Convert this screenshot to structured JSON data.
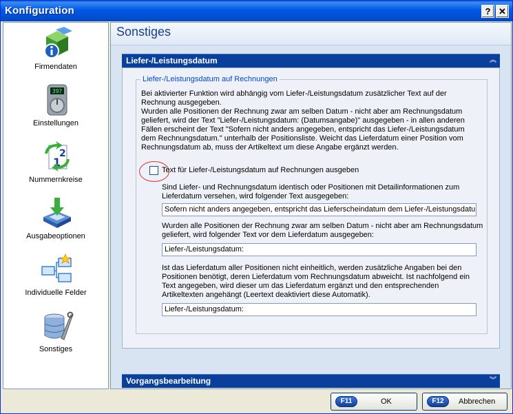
{
  "window": {
    "title": "Konfiguration",
    "help_label": "?",
    "close_label": "✕"
  },
  "sidebar": {
    "items": [
      {
        "label": "Firmendaten",
        "icon": "company-info-icon"
      },
      {
        "label": "Einstellungen",
        "icon": "settings-dial-icon"
      },
      {
        "label": "Nummernkreise",
        "icon": "number-cycle-icon"
      },
      {
        "label": "Ausgabeoptionen",
        "icon": "output-tray-icon"
      },
      {
        "label": "Individuelle Felder",
        "icon": "custom-fields-icon"
      },
      {
        "label": "Sonstiges",
        "icon": "database-tools-icon"
      }
    ],
    "selected": "Sonstiges"
  },
  "main": {
    "title": "Sonstiges",
    "section1": {
      "title": "Liefer-/Leistungsdatum",
      "group_title": "Liefer-/Leistungsdatum auf Rechnungen",
      "description": [
        "Bei aktivierter Funktion wird abhängig vom Liefer-/Leistungsdatum zusätzlicher Text auf der",
        "Rechnung ausgegeben.",
        "Wurden alle Positionen der Rechnung zwar am selben Datum - nicht aber am Rechnungsdatum",
        "geliefert, wird der Text \"Liefer-/Leistungsdatum: (Datumsangabe)\" ausgegeben - in allen anderen",
        "Fällen erscheint der Text \"Sofern nicht anders angegeben, entspricht das Liefer-/Leistungsdatum",
        "dem Rechnungsdatum.\" unterhalb der Positionsliste. Weicht das Lieferdatum einer Position vom",
        "Rechnungsdatum ab, muss der Artikeltext um diese Angabe ergänzt werden."
      ],
      "checkbox_label": "Text für Liefer-/Leistungsdatum auf Rechnungen ausgeben",
      "checkbox_checked": false,
      "text1": [
        "Sind Liefer- und Rechnungsdatum identisch oder Positionen mit Detailinformationen zum",
        "Lieferdatum versehen, wird folgender Text ausgegeben:"
      ],
      "field1_value": "Sofern nicht anders angegeben, entspricht das Lieferscheindatum dem Liefer-/Leistungsdatum",
      "text2": [
        "Wurden alle Positionen der Rechnung zwar am selben Datum - nicht aber am Rechnungsdatum",
        "geliefert, wird folgender Text vor dem Lieferdatum ausgegeben:"
      ],
      "field2_value": "Liefer-/Leistungsdatum:",
      "text3": [
        "Ist das Lieferdatum aller Positionen nicht einheitlich, werden zusätzliche Angaben bei den",
        "Positionen benötigt, deren Lieferdatum vom Rechnungsdatum abweicht. Ist nachfolgend ein",
        "Text angegeben, wird dieser um das Lieferdatum ergänzt und den entsprechenden",
        "Artikeltexten angehängt (Leertext deaktiviert diese Automatik)."
      ],
      "field3_value": "Liefer-/Leistungsdatum:"
    },
    "section2": {
      "title": "Vorgangsbearbeitung"
    }
  },
  "buttons": {
    "ok": {
      "key": "F11",
      "label": "OK"
    },
    "cancel": {
      "key": "F12",
      "label": "Abbrechen"
    }
  }
}
